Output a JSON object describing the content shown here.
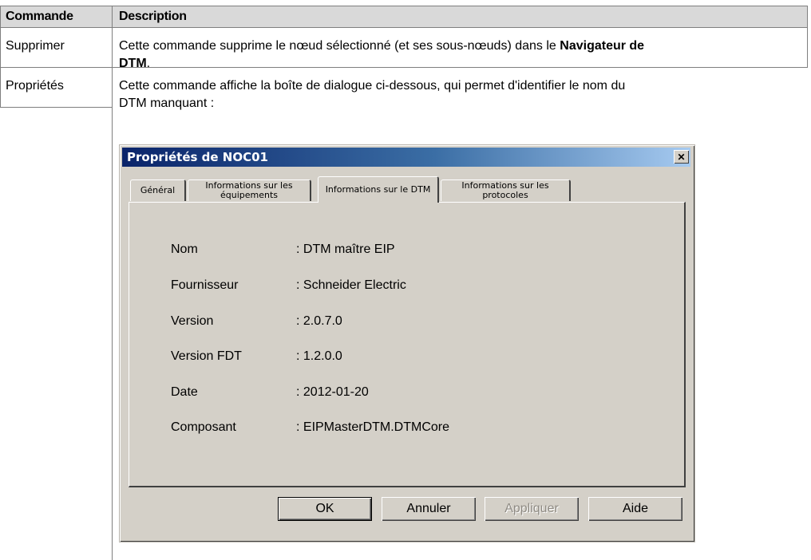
{
  "table": {
    "headers": [
      "Commande",
      "Description"
    ],
    "rows": [
      {
        "command": "Supprimer",
        "description_part1": "Cette commande supprime le nœud sélectionné (et ses sous-nœuds) dans le ",
        "description_bold1": "Navigateur de",
        "description_bold2": "DTM",
        "description_end": "."
      },
      {
        "command": "Propriétés",
        "description_line1": "Cette commande affiche la boîte de dialogue ci-dessous, qui permet d'identifier le nom du",
        "description_line2": "DTM manquant :"
      }
    ]
  },
  "dialog": {
    "title": "Propriétés de NOC01",
    "close_symbol": "✕",
    "tabs": [
      {
        "label": "Général"
      },
      {
        "label_line1": "Informations sur les",
        "label_line2": "équipements"
      },
      {
        "label": "Informations sur le DTM",
        "active": true
      },
      {
        "label_line1": "Informations sur les",
        "label_line2": "protocoles"
      }
    ],
    "info": [
      {
        "label": "Nom",
        "value": ": DTM maître EIP"
      },
      {
        "label": "Fournisseur",
        "value": ": Schneider Electric"
      },
      {
        "label": "Version",
        "value": ": 2.0.7.0"
      },
      {
        "label": "Version FDT",
        "value": ": 1.2.0.0"
      },
      {
        "label": "Date",
        "value": ": 2012-01-20"
      },
      {
        "label": "Composant",
        "value": ": EIPMasterDTM.DTMCore"
      }
    ],
    "buttons": {
      "ok": "OK",
      "cancel": "Annuler",
      "apply": "Appliquer",
      "help": "Aide"
    }
  }
}
